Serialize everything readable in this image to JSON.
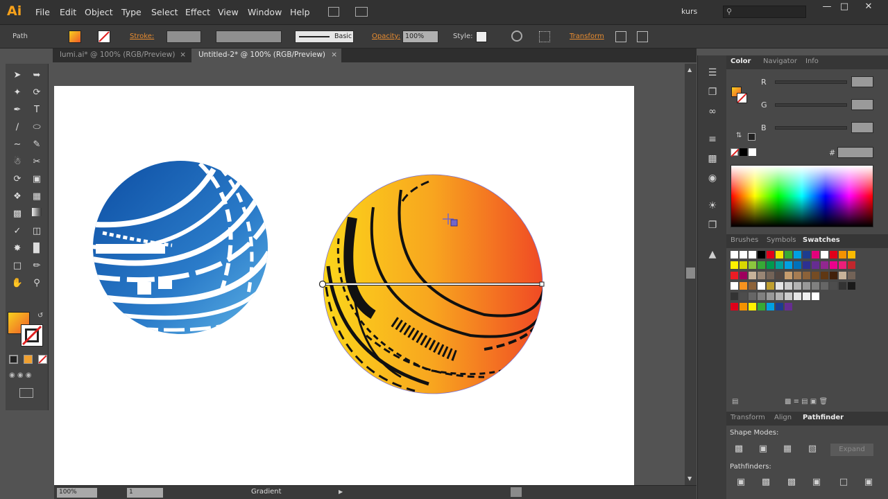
{
  "app": {
    "logo": "Ai",
    "user": "kurs"
  },
  "menu": [
    "File",
    "Edit",
    "Object",
    "Type",
    "Select",
    "Effect",
    "View",
    "Window",
    "Help"
  ],
  "control": {
    "object_type": "Path",
    "stroke_label": "Stroke:",
    "brush_label": "Basic",
    "opacity_label": "Opacity:",
    "opacity_value": "100%",
    "style_label": "Style:",
    "transform_label": "Transform"
  },
  "tabs": [
    {
      "label": "lumi.ai* @ 100% (RGB/Preview)",
      "active": false
    },
    {
      "label": "Untitled-2* @ 100% (RGB/Preview)",
      "active": true
    }
  ],
  "status": {
    "zoom": "100%",
    "page": "1",
    "tool": "Gradient"
  },
  "color_panel": {
    "tabs": [
      "Color",
      "Navigator",
      "Info"
    ],
    "channels": [
      "R",
      "G",
      "B"
    ],
    "hex_label": "#"
  },
  "swatches_panel": {
    "tabs": [
      "Brushes",
      "Symbols",
      "Swatches"
    ]
  },
  "pathfinder_panel": {
    "tabs": [
      "Transform",
      "Align",
      "Pathfinder"
    ],
    "shape_modes_label": "Shape Modes:",
    "pathfinders_label": "Pathfinders:",
    "expand_label": "Expand"
  },
  "colors": {
    "fill_gradient_start": "#f7d11e",
    "fill_gradient_end": "#f05a28",
    "globe_blue": "#1f62b6",
    "accent": "#f7a11a"
  },
  "icons": {
    "close": "close-icon",
    "search": "search-icon",
    "layers": "layers-icon",
    "gradient_crosshair": "gradient-crosshair-icon"
  }
}
